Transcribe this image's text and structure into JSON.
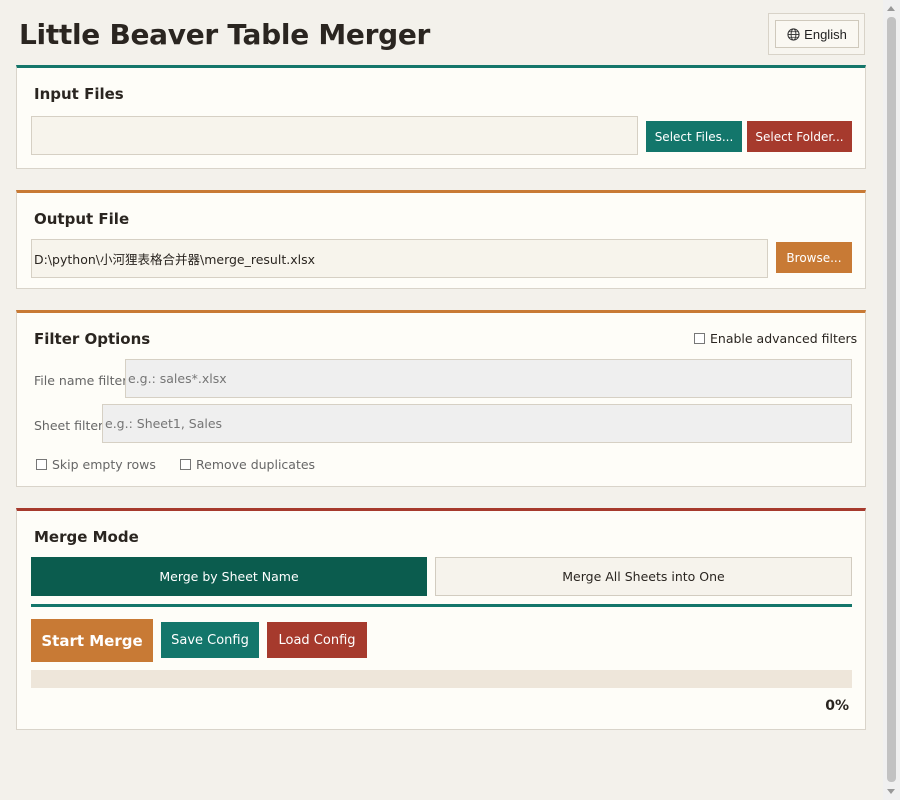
{
  "app": {
    "title": "Little Beaver Table Merger",
    "language_button": "English"
  },
  "input_files": {
    "title": "Input Files",
    "path_value": "",
    "select_files_button": "Select Files...",
    "select_folder_button": "Select Folder..."
  },
  "output_file": {
    "title": "Output File",
    "path_value": "D:\\python\\小河狸表格合并器\\merge_result.xlsx",
    "browse_button": "Browse..."
  },
  "filter_options": {
    "title": "Filter Options",
    "enable_advanced_label": "Enable advanced filters",
    "enable_advanced_checked": false,
    "file_name_filter_label": "File name filter:",
    "file_name_filter_placeholder": "e.g.: sales*.xlsx",
    "sheet_filter_label": "Sheet filter:",
    "sheet_filter_placeholder": "e.g.: Sheet1, Sales",
    "skip_empty_rows_label": "Skip empty rows",
    "skip_empty_rows_checked": false,
    "remove_duplicates_label": "Remove duplicates",
    "remove_duplicates_checked": false
  },
  "merge_mode": {
    "title": "Merge Mode",
    "options": [
      "Merge by Sheet Name",
      "Merge All Sheets into One"
    ],
    "selected": "Merge by Sheet Name"
  },
  "actions": {
    "start_merge_button": "Start Merge",
    "save_config_button": "Save Config",
    "load_config_button": "Load Config"
  },
  "progress": {
    "value": 0,
    "label": "0%"
  },
  "colors": {
    "teal": "#13766b",
    "dark_teal": "#0b5c4e",
    "orange": "#c87a35",
    "red": "#a63a2d",
    "background": "#f3f1eb",
    "panel": "#fefdf8"
  },
  "icons": {
    "language": "globe-icon"
  }
}
